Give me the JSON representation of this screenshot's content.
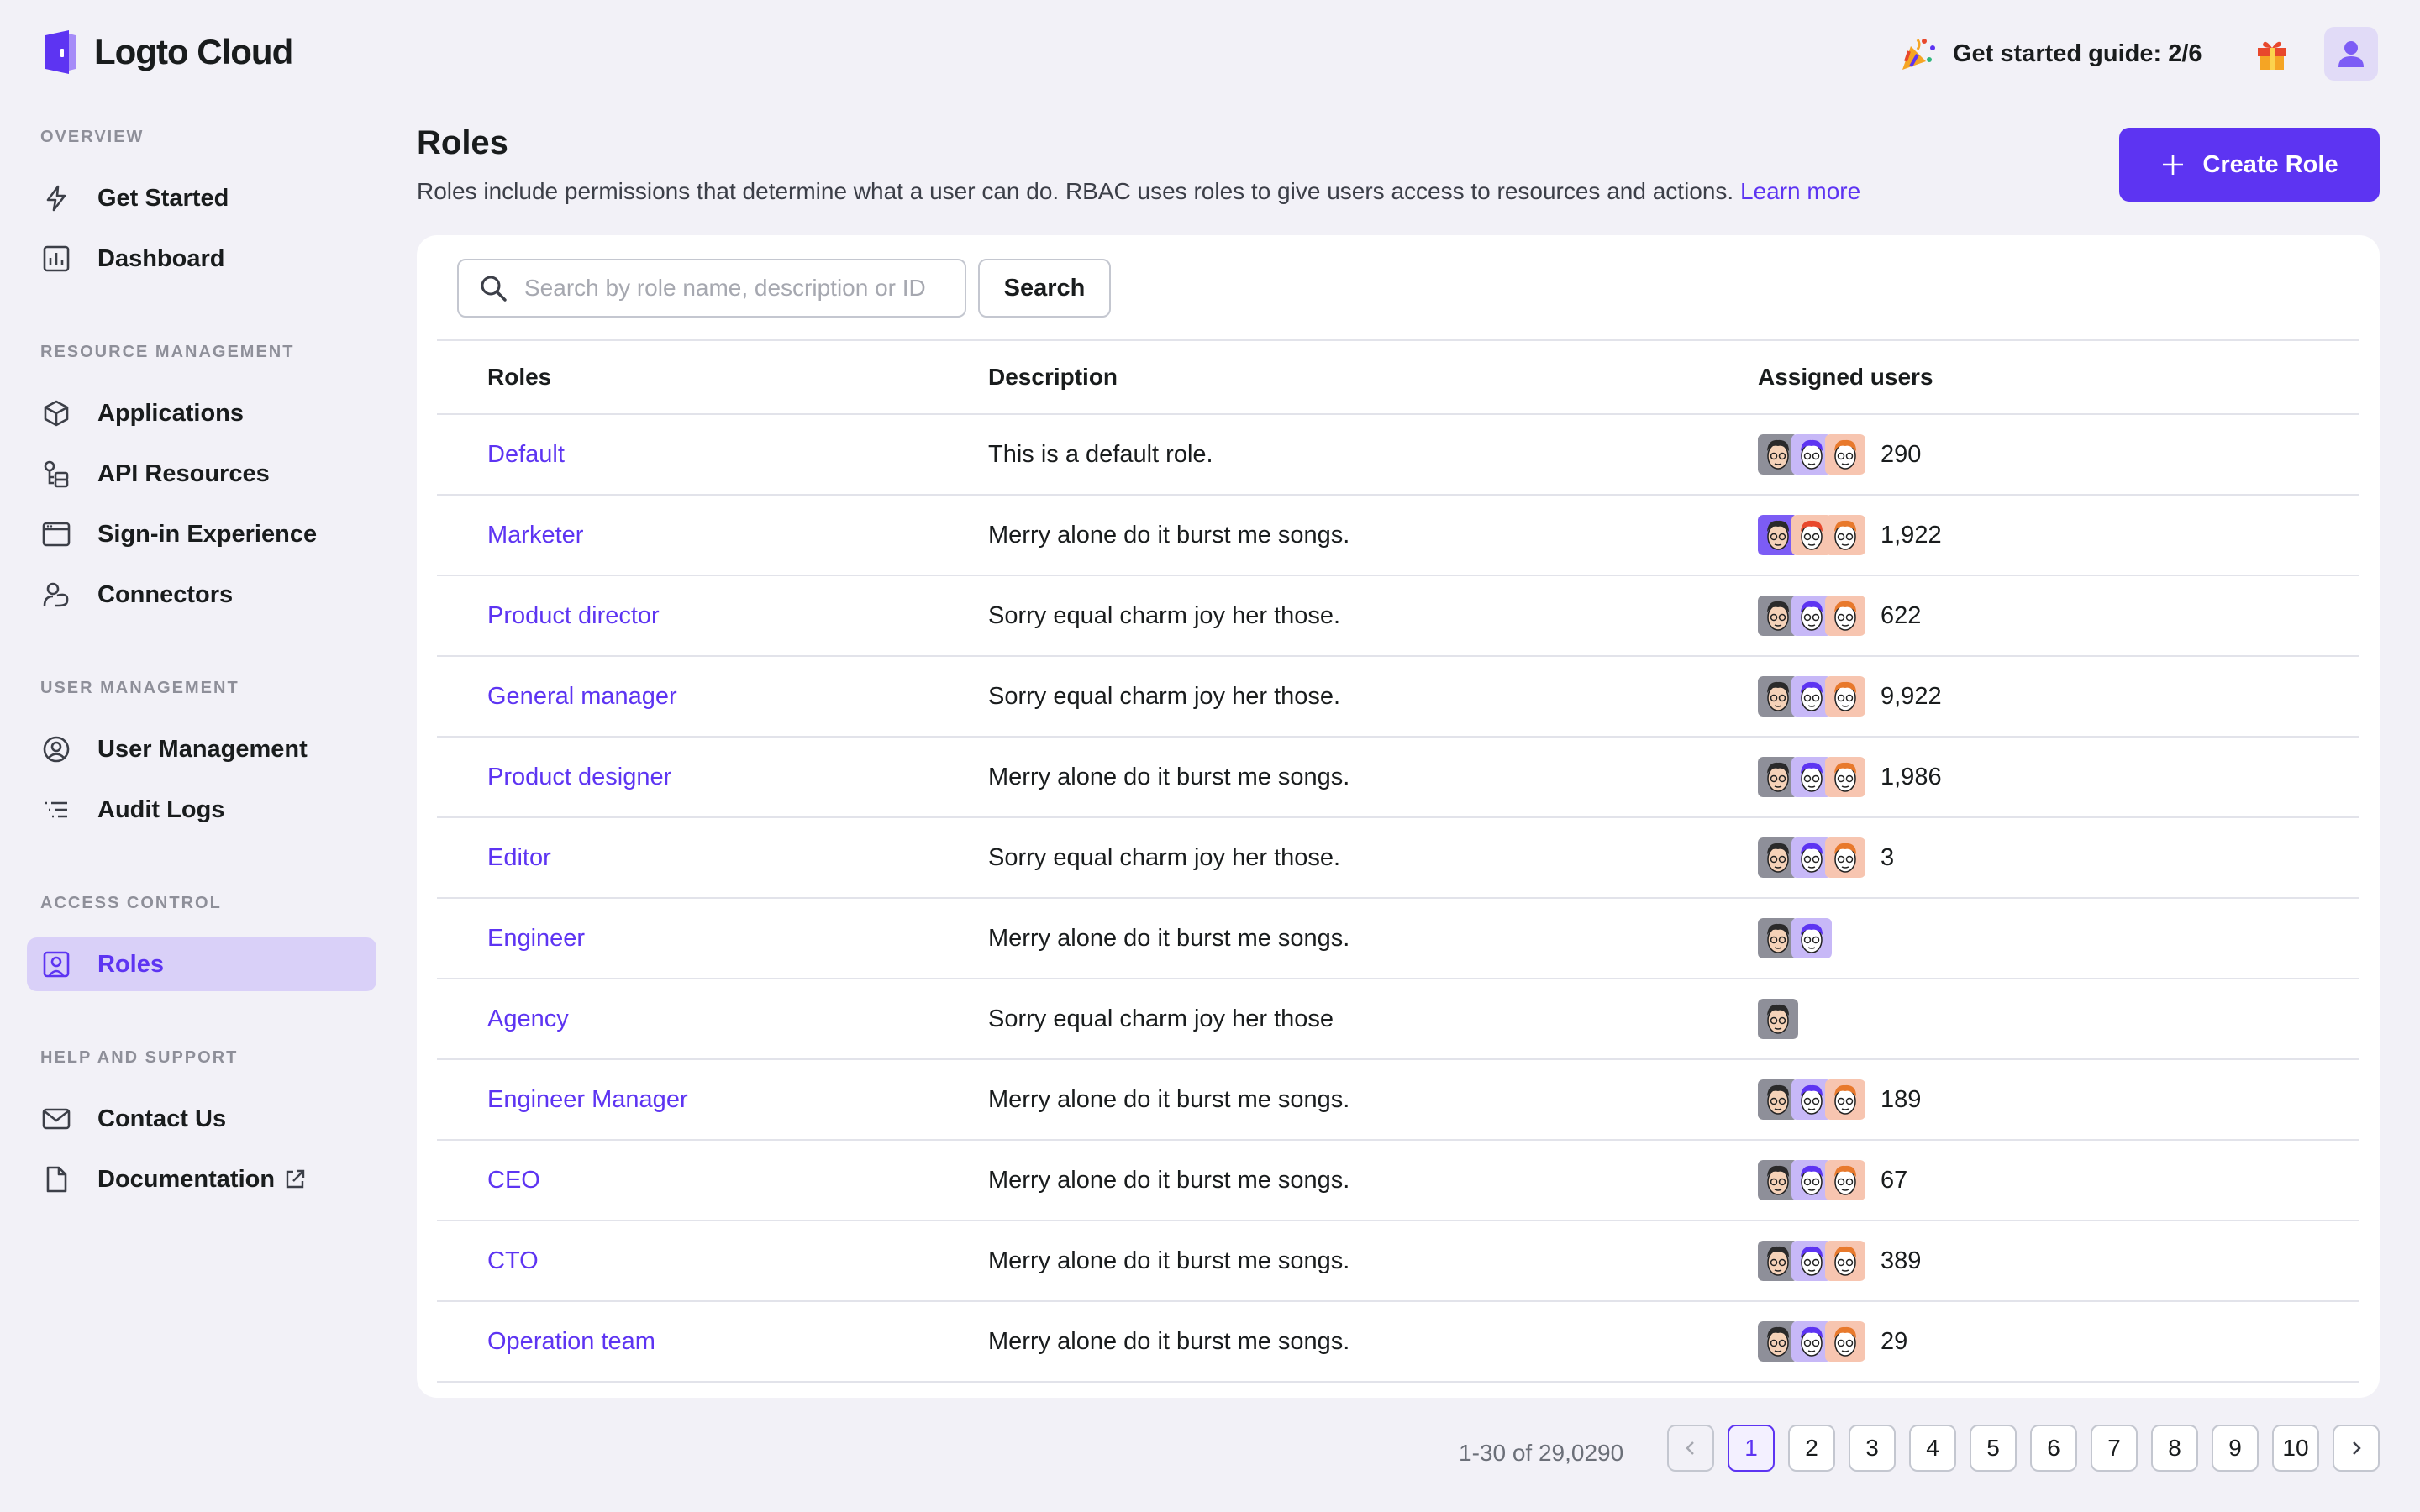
{
  "app": {
    "title": "Logto Cloud"
  },
  "topbar": {
    "guide_label": "Get started guide: 2/6",
    "icons": [
      "party-popper-icon",
      "gift-icon",
      "user-avatar-icon"
    ]
  },
  "sidebar": {
    "sections": [
      {
        "title": "OVERVIEW",
        "items": [
          {
            "label": "Get Started",
            "icon": "lightning-icon"
          },
          {
            "label": "Dashboard",
            "icon": "chart-icon"
          }
        ]
      },
      {
        "title": "RESOURCE MANAGEMENT",
        "items": [
          {
            "label": "Applications",
            "icon": "cube-icon"
          },
          {
            "label": "API Resources",
            "icon": "api-icon"
          },
          {
            "label": "Sign-in Experience",
            "icon": "browser-icon"
          },
          {
            "label": "Connectors",
            "icon": "connector-icon"
          }
        ]
      },
      {
        "title": "USER MANAGEMENT",
        "items": [
          {
            "label": "User Management",
            "icon": "user-circle-icon"
          },
          {
            "label": "Audit Logs",
            "icon": "list-icon"
          }
        ]
      },
      {
        "title": "ACCESS CONTROL",
        "items": [
          {
            "label": "Roles",
            "icon": "role-badge-icon",
            "active": true
          }
        ]
      },
      {
        "title": "HELP AND SUPPORT",
        "items": [
          {
            "label": "Contact Us",
            "icon": "mail-icon"
          },
          {
            "label": "Documentation",
            "icon": "document-icon"
          }
        ]
      }
    ]
  },
  "header": {
    "title": "Roles",
    "subtitle": "Roles include permissions that determine what a user can do. RBAC uses roles to give users access to resources and actions.",
    "learn_more": "Learn more",
    "create_button": "Create Role"
  },
  "search": {
    "placeholder": "Search by role name, description or ID",
    "value": "",
    "button": "Search"
  },
  "table": {
    "columns": [
      "Roles",
      "Description",
      "Assigned users"
    ],
    "rows": [
      {
        "role": "Default",
        "description": "This is a default role.",
        "faces": 3,
        "count": "290"
      },
      {
        "role": "Marketer",
        "description": "Merry alone do it burst me songs.",
        "faces": 3,
        "count": "1,922"
      },
      {
        "role": "Product director",
        "description": "Sorry equal charm joy her those.",
        "faces": 3,
        "count": "622"
      },
      {
        "role": "General manager",
        "description": "Sorry equal charm joy her those.",
        "faces": 3,
        "count": "9,922"
      },
      {
        "role": "Product designer",
        "description": "Merry alone do it burst me songs.",
        "faces": 3,
        "count": "1,986"
      },
      {
        "role": "Editor",
        "description": "Sorry equal charm joy her those.",
        "faces": 3,
        "count": "3"
      },
      {
        "role": "Engineer",
        "description": "Merry alone do it burst me songs.",
        "faces": 2,
        "count": ""
      },
      {
        "role": "Agency",
        "description": "Sorry equal charm joy her those",
        "faces": 1,
        "count": ""
      },
      {
        "role": "Engineer Manager",
        "description": "Merry alone do it burst me songs.",
        "faces": 3,
        "count": "189"
      },
      {
        "role": "CEO",
        "description": "Merry alone do it burst me songs.",
        "faces": 3,
        "count": "67"
      },
      {
        "role": "CTO",
        "description": "Merry alone do it burst me songs.",
        "faces": 3,
        "count": "389"
      },
      {
        "role": "Operation team",
        "description": "Merry alone do it burst me songs.",
        "faces": 3,
        "count": "29"
      }
    ]
  },
  "pagination": {
    "summary": "1-30 of 29,0290",
    "pages": [
      "1",
      "2",
      "3",
      "4",
      "5",
      "6",
      "7",
      "8",
      "9",
      "10"
    ],
    "current": "1"
  },
  "colors": {
    "accent": "#5d34f2",
    "active_nav_bg": "#d9d0f8",
    "page_bg": "#f2f1f7"
  }
}
